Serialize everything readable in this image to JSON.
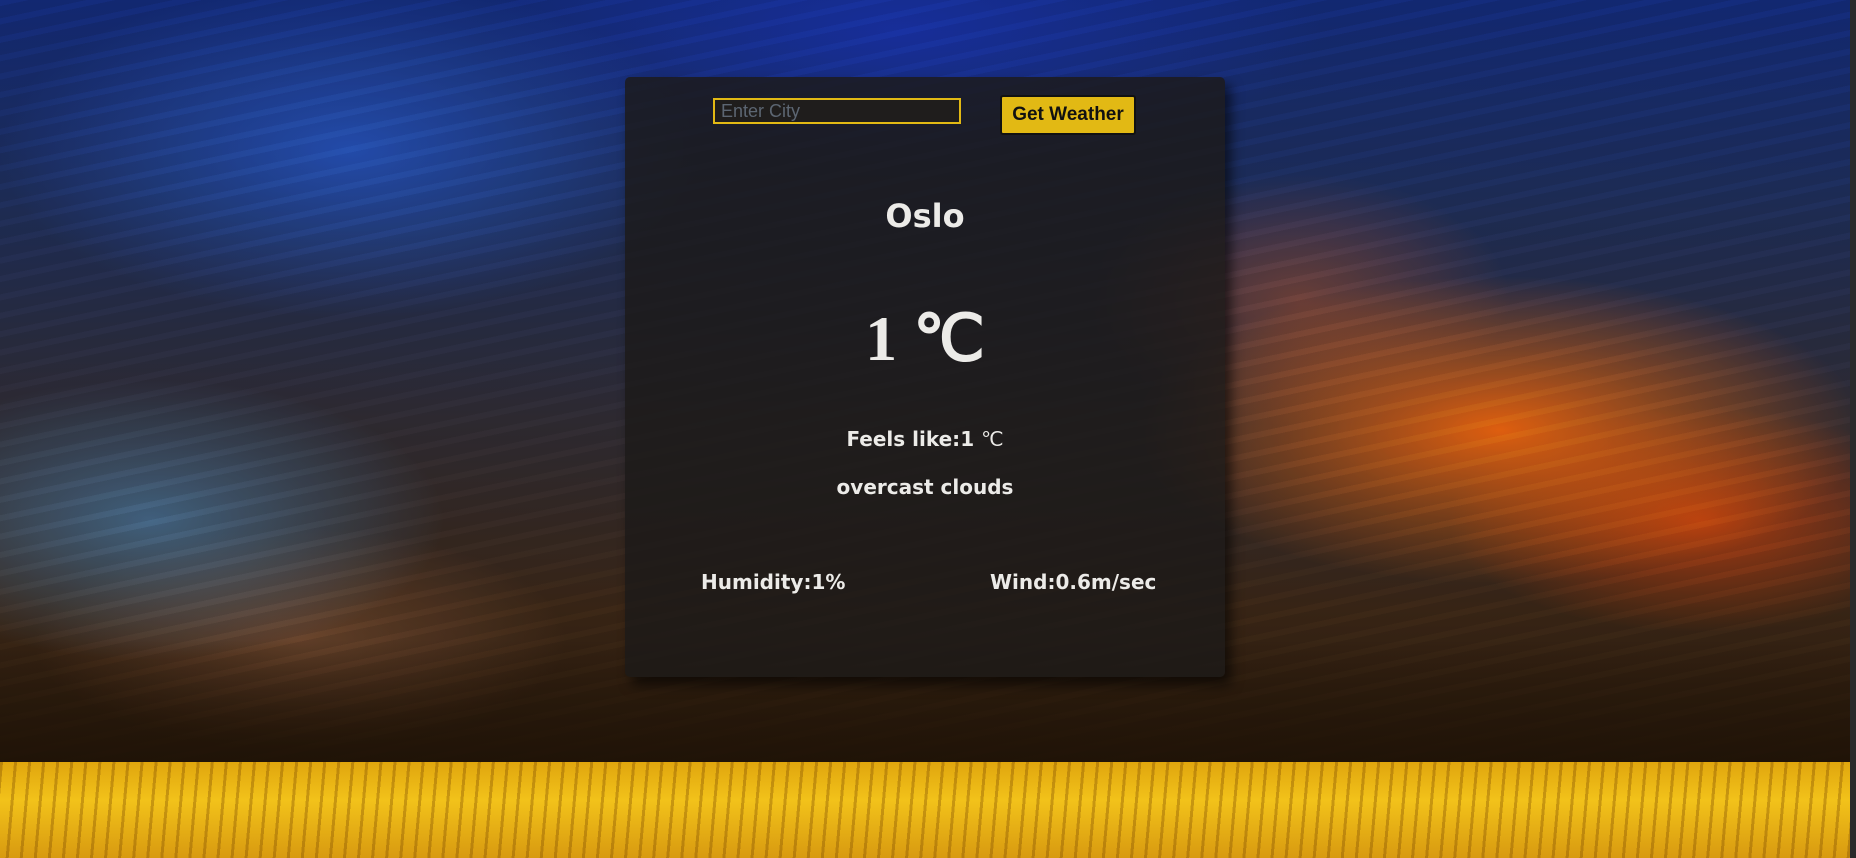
{
  "search": {
    "placeholder": "Enter City",
    "value": "",
    "button_label": "Get Weather"
  },
  "weather": {
    "city": "Oslo",
    "temperature": "1",
    "temperature_unit": "℃",
    "feels_like_label": "Feels like:",
    "feels_like_value": "1",
    "feels_like_unit": "℃",
    "description": "overcast clouds",
    "humidity_label": "Humidity:",
    "humidity_value": "1%",
    "wind_label": "Wind:",
    "wind_value": "0.6m/sec"
  },
  "colors": {
    "accent": "#e2b914",
    "card_background": "#1c1a19",
    "text": "#ecebe8"
  },
  "background": {
    "description_icon": "sunset-sky-over-wheat-field-image"
  }
}
